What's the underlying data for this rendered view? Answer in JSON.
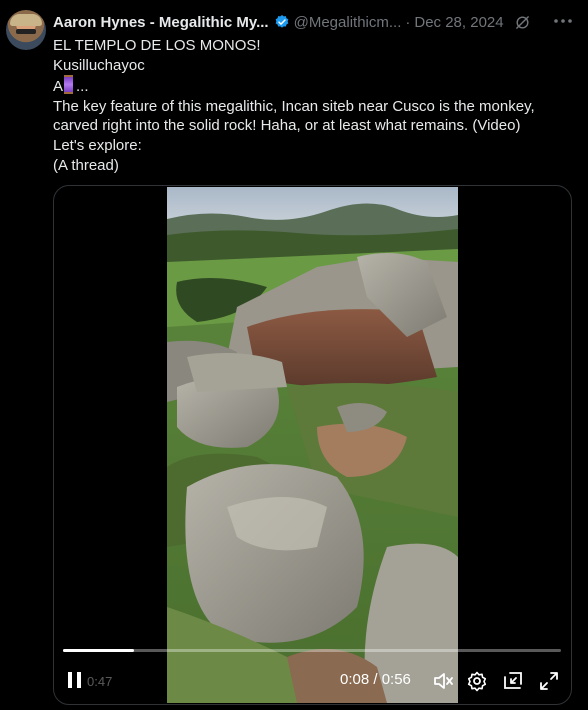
{
  "tweet": {
    "author_name": "Aaron Hynes - Megalithic My...",
    "handle": "@Megalithicm...",
    "separator": "·",
    "date": "Dec 28, 2024",
    "lines": [
      "EL TEMPLO DE LOS MONOS!",
      "Kusilluchayoc",
      "The key feature of this megalithic, Incan siteb near Cusco is the monkey, carved right into the solid rock! Haha, or at least what remains. (Video)",
      "Let's explore:",
      "(A thread)"
    ],
    "line3_prefix": "A",
    "line3_suffix": "...",
    "line3_emoji": "spool-of-thread-emoji"
  },
  "icons": {
    "verified": "verified-badge-icon",
    "grok": "grok-icon",
    "more": "more-icon"
  },
  "video": {
    "faded_elapsed": "0:47",
    "time_display": "0:08 / 0:56",
    "progress_fraction": 0.143,
    "controls": [
      "pause-icon",
      "mute-icon",
      "settings-icon",
      "pip-icon",
      "fullscreen-icon"
    ]
  },
  "colors": {
    "background": "#000000",
    "text": "#e7e9ea",
    "secondary": "#71767b",
    "verified": "#1d9bf0"
  }
}
